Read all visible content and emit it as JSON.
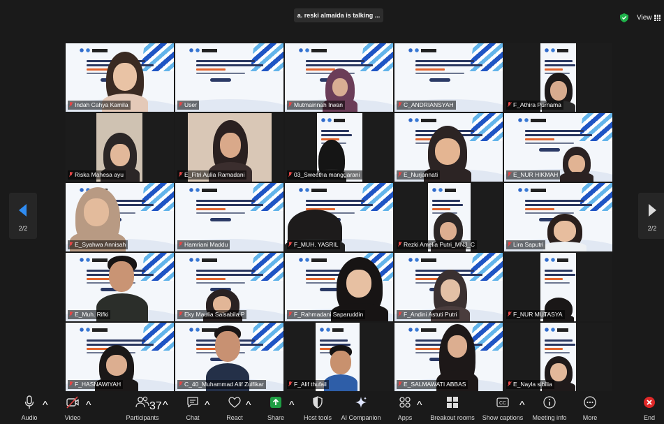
{
  "meeting": {
    "speaking_banner": "a. reski almaida is talking ...",
    "view_label": "View",
    "page_indicator_left": "2/2",
    "page_indicator_right": "2/2"
  },
  "participants": [
    {
      "name": "Indah Cahya Kamila"
    },
    {
      "name": "User"
    },
    {
      "name": "Mutmainnah Irwan"
    },
    {
      "name": "C_ANDRIANSYAH"
    },
    {
      "name": "F_Athira Purnama"
    },
    {
      "name": "Riska Mahesa ayu"
    },
    {
      "name": "E_Fitri Aulia Ramadani"
    },
    {
      "name": "03_Sweetha manggarani"
    },
    {
      "name": "E_Nurjannati"
    },
    {
      "name": "E_NUR HIKMAH"
    },
    {
      "name": "E_Syahwa Annisah"
    },
    {
      "name": "Hamriani Maddu"
    },
    {
      "name": "F_MUH. YASRIL"
    },
    {
      "name": "Rezki Amelia Putri_MNJ_C"
    },
    {
      "name": "Lira Saputri"
    },
    {
      "name": "E_Muh. Rifki"
    },
    {
      "name": "Eky Maulia Salsabila.P"
    },
    {
      "name": "F_Rahmadani Saparuddin"
    },
    {
      "name": "F_Andini Astuti Putri"
    },
    {
      "name": "F_NUR MUTASYA"
    },
    {
      "name": "F_HASNAWIYAH"
    },
    {
      "name": "C_40_Muhammad Alif Zulfikar"
    },
    {
      "name": "F_Alif thufail"
    },
    {
      "name": "E_SALMAWATI ABBAS"
    },
    {
      "name": "E_Nayla sibilia"
    }
  ],
  "toolbar": {
    "audio": "Audio",
    "video": "Video",
    "participants": "Participants",
    "participants_count": "37",
    "chat": "Chat",
    "react": "React",
    "share": "Share",
    "host_tools": "Host tools",
    "ai_companion": "AI Companion",
    "apps": "Apps",
    "breakout_rooms": "Breakout rooms",
    "show_captions": "Show captions",
    "meeting_info": "Meeting info",
    "more": "More",
    "end": "End"
  },
  "colors": {
    "background": "#1a1a1a",
    "accent_blue": "#2f8cf2",
    "muted_red": "#e54646",
    "share_green": "#1f9e44",
    "end_red": "#e02828"
  }
}
